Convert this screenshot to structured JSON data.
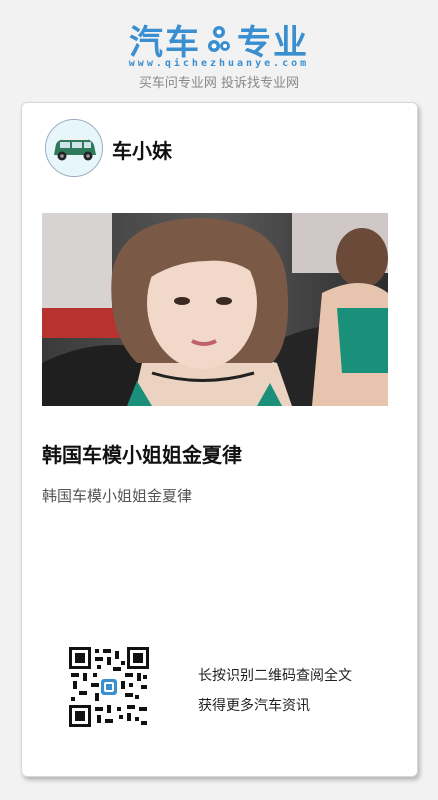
{
  "header": {
    "logo_left": "汽车",
    "logo_right": "专业",
    "site_url": "www.qichezhuanye.com",
    "slogan": "买车问专业网 投诉找专业网",
    "brand_color": "#3a8fd0"
  },
  "author": {
    "name": "车小妹",
    "avatar_icon": "car-avatar-icon"
  },
  "article": {
    "title": "韩国车模小姐姐金夏律",
    "summary": "韩国车模小姐姐金夏律",
    "photo_icon": "article-photo"
  },
  "qr": {
    "line1": "长按识别二维码查阅全文",
    "line2": "获得更多汽车资讯",
    "icon": "qr-code-icon"
  }
}
